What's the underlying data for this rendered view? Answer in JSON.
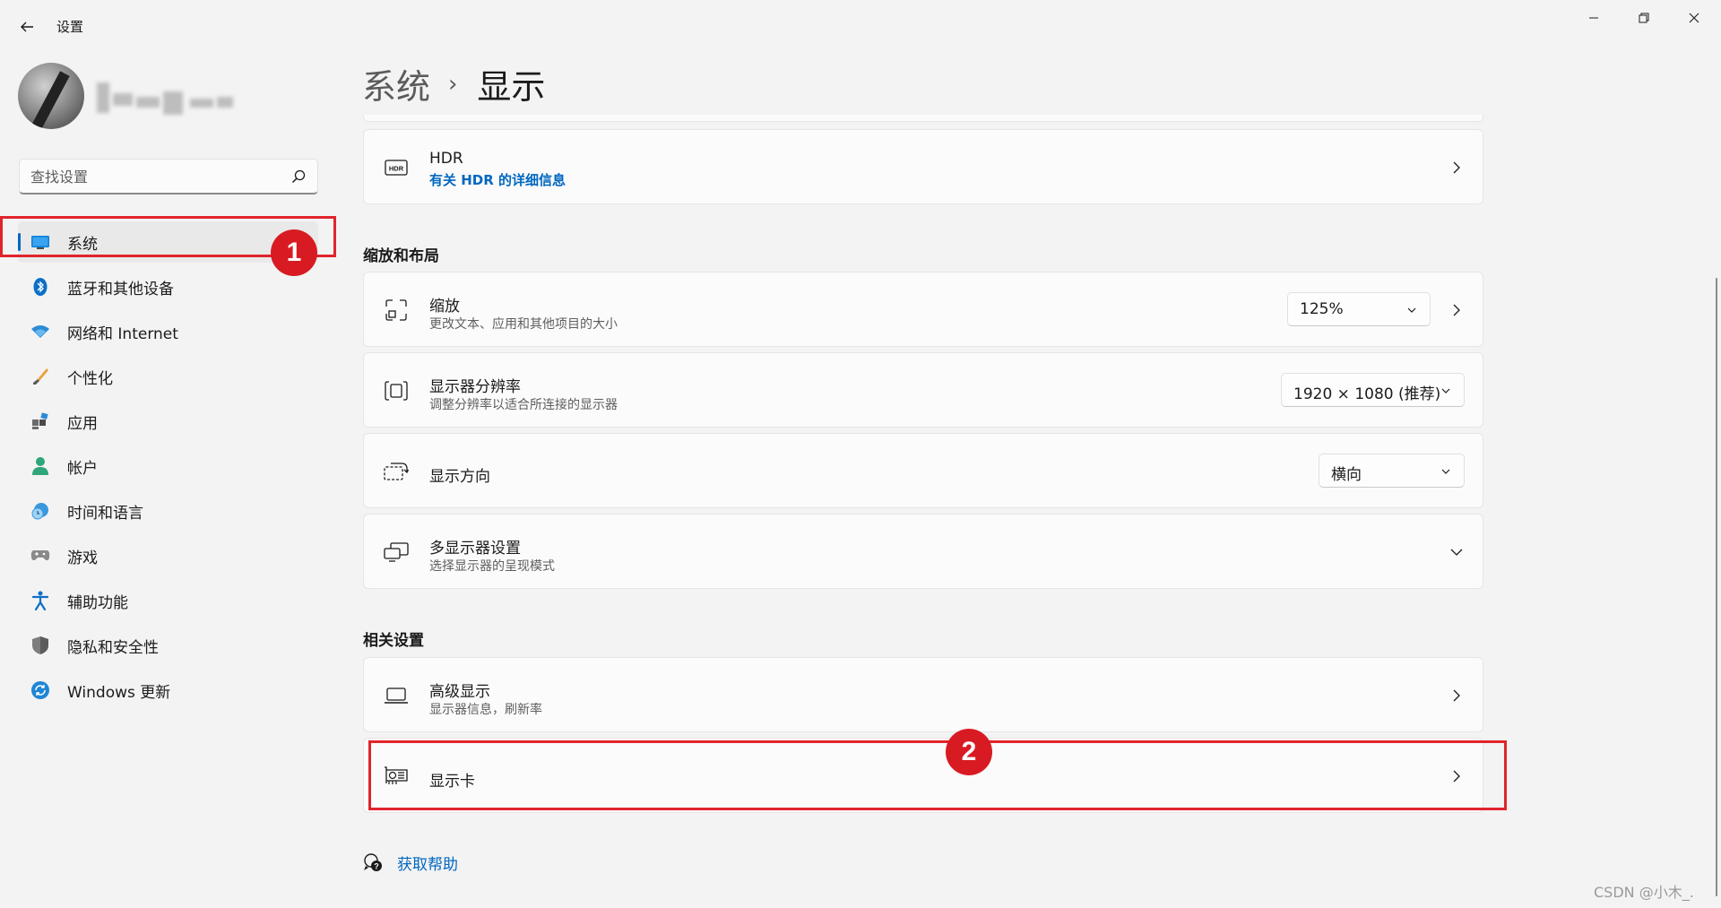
{
  "window": {
    "app_title": "设置",
    "back_icon": "arrow-left-icon",
    "minimize_icon": "minimize-icon",
    "maximize_icon": "restore-icon",
    "close_icon": "close-icon"
  },
  "sidebar": {
    "search_placeholder": "查找设置",
    "items": [
      {
        "label": "系统",
        "icon": "monitor-icon",
        "active": true
      },
      {
        "label": "蓝牙和其他设备",
        "icon": "bluetooth-icon"
      },
      {
        "label": "网络和 Internet",
        "icon": "wifi-icon"
      },
      {
        "label": "个性化",
        "icon": "brush-icon"
      },
      {
        "label": "应用",
        "icon": "apps-icon"
      },
      {
        "label": "帐户",
        "icon": "person-icon"
      },
      {
        "label": "时间和语言",
        "icon": "clock-globe-icon"
      },
      {
        "label": "游戏",
        "icon": "gamepad-icon"
      },
      {
        "label": "辅助功能",
        "icon": "accessibility-icon"
      },
      {
        "label": "隐私和安全性",
        "icon": "shield-icon"
      },
      {
        "label": "Windows 更新",
        "icon": "update-icon"
      }
    ]
  },
  "main": {
    "breadcrumb": {
      "parent": "系统",
      "separator": "›",
      "current": "显示"
    },
    "hdr": {
      "title": "HDR",
      "link": "有关 HDR 的详细信息"
    },
    "scale_layout": {
      "heading": "缩放和布局",
      "scale": {
        "title": "缩放",
        "subtitle": "更改文本、应用和其他项目的大小",
        "value": "125%"
      },
      "resolution": {
        "title": "显示器分辨率",
        "subtitle": "调整分辨率以适合所连接的显示器",
        "value": "1920 × 1080 (推荐)"
      },
      "orientation": {
        "title": "显示方向",
        "value": "横向"
      },
      "multi_display": {
        "title": "多显示器设置",
        "subtitle": "选择显示器的呈现模式"
      }
    },
    "related": {
      "heading": "相关设置",
      "advanced": {
        "title": "高级显示",
        "subtitle": "显示器信息，刷新率"
      },
      "gpu": {
        "title": "显示卡"
      }
    },
    "help": {
      "label": "获取帮助"
    }
  },
  "annotations": {
    "marker_1": "1",
    "marker_2": "2"
  },
  "watermark": "CSDN @小木_.",
  "colors": {
    "accent": "#0067c0",
    "annotation_red": "#e0242b",
    "background": "#f3f3f3",
    "card": "#fbfbfb"
  }
}
